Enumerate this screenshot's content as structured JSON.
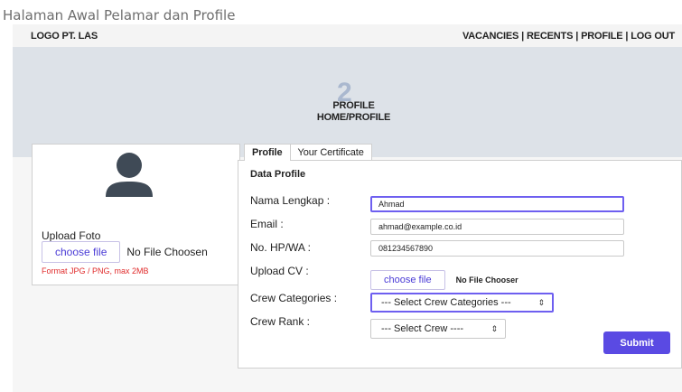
{
  "page": {
    "heading": "Halaman Awal Pelamar dan Profile"
  },
  "topbar": {
    "logo": "LOGO PT. LAS",
    "nav": [
      {
        "label": "VACANCIES"
      },
      {
        "label": "RECENTS"
      },
      {
        "label": "PROFILE"
      },
      {
        "label": "LOG OUT"
      }
    ],
    "separator": "|"
  },
  "banner": {
    "title": "PROFILE",
    "breadcrumb": "HOME/PROFILE",
    "bg_glyph": "2"
  },
  "photo": {
    "upload_label": "Upload Foto",
    "choose_label": "choose file",
    "file_status": "No File Choosen",
    "format_note": "Format JPG / PNG, max 2MB"
  },
  "tabs": [
    {
      "label": "Profile",
      "active": true
    },
    {
      "label": "Your Certificate",
      "active": false
    }
  ],
  "form": {
    "section_title": "Data Profile",
    "name_label": "Nama Lengkap :",
    "name_value": "Ahmad",
    "email_label": "Email :",
    "email_value": "ahmad@example.co.id",
    "phone_label": "No. HP/WA :",
    "phone_value": "081234567890",
    "cv_label": "Upload CV :",
    "cv_choose_label": "choose file",
    "cv_file_status": "No File Chooser",
    "crew_categories_label": "Crew Categories :",
    "crew_categories_selected": "--- Select Crew Categories ---",
    "crew_rank_label": "Crew Rank :",
    "crew_rank_selected": "--- Select Crew ----",
    "submit_label": "Submit"
  },
  "colors": {
    "accent": "#5a4ae3",
    "focus_border": "#6e5ff0",
    "banner_bg": "#dde2e8",
    "error_text": "#e02b2b"
  },
  "icons": {
    "avatar": "user-avatar-icon",
    "select_arrow": "updown-arrow-icon"
  }
}
